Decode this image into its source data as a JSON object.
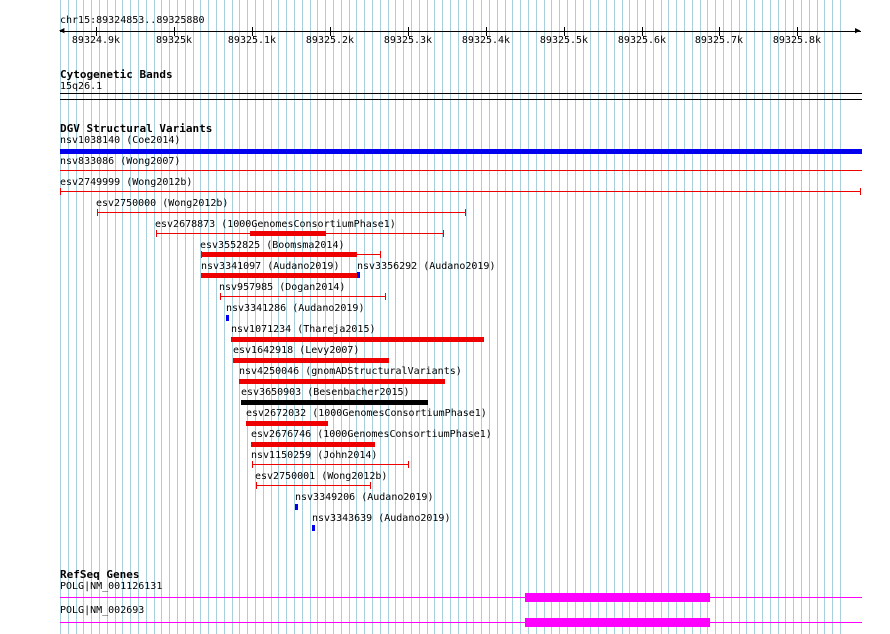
{
  "region": "chr15:89324853..89325880",
  "ruler": {
    "ticks": [
      "89324.9k",
      "89325k",
      "89325.1k",
      "89325.2k",
      "89325.3k",
      "89325.4k",
      "89325.5k",
      "89325.6k",
      "89325.7k",
      "89325.8k"
    ]
  },
  "cyto": {
    "title": "Cytogenetic Bands",
    "band": "15q26.1"
  },
  "dgv": {
    "title": "DGV Structural Variants",
    "tracks": [
      {
        "label": "nsv1038140 (Coe2014)",
        "type": "thick",
        "color": "#0000ee"
      },
      {
        "label": "nsv833086 (Wong2007)",
        "type": "thin",
        "color": "#ee0000"
      },
      {
        "label": "esv2749999 (Wong2012b)",
        "type": "thin",
        "color": "#ee0000"
      },
      {
        "label": "esv2750000 (Wong2012b)",
        "type": "thin",
        "color": "#ee0000"
      },
      {
        "label": "esv2678873 (1000GenomesConsortiumPhase1)",
        "type": "thinwithblock",
        "color": "#ee0000"
      },
      {
        "label": "esv3552825 (Boomsma2014)",
        "type": "thinwithblock",
        "color": "#ee0000"
      },
      {
        "label": "nsv3341097 (Audano2019)",
        "type": "thick",
        "color": "#ee0000"
      },
      {
        "label": "nsv3356292 (Audano2019)",
        "type": "tiny",
        "color": "#0000ee"
      },
      {
        "label": "nsv957985 (Dogan2014)",
        "type": "thin",
        "color": "#ee0000"
      },
      {
        "label": "nsv3341286 (Audano2019)",
        "type": "tiny",
        "color": "#0000ee"
      },
      {
        "label": "nsv1071234 (Thareja2015)",
        "type": "thick",
        "color": "#ee0000"
      },
      {
        "label": "esv1642918 (Levy2007)",
        "type": "thick",
        "color": "#ee0000"
      },
      {
        "label": "nsv4250046 (gnomADStructuralVariants)",
        "type": "thick",
        "color": "#ee0000"
      },
      {
        "label": "esv3650903 (Besenbacher2015)",
        "type": "thick",
        "color": "#000000"
      },
      {
        "label": "esv2672032 (1000GenomesConsortiumPhase1)",
        "type": "thick",
        "color": "#ee0000"
      },
      {
        "label": "esv2676746 (1000GenomesConsortiumPhase1)",
        "type": "thick",
        "color": "#ee0000"
      },
      {
        "label": "nsv1150259 (John2014)",
        "type": "thin",
        "color": "#ee0000"
      },
      {
        "label": "esv2750001 (Wong2012b)",
        "type": "thin",
        "color": "#ee0000"
      },
      {
        "label": "nsv3349206 (Audano2019)",
        "type": "tiny",
        "color": "#0000ee"
      },
      {
        "label": "nsv3343639 (Audano2019)",
        "type": "tiny",
        "color": "#0000ee"
      }
    ]
  },
  "refseq": {
    "title": "RefSeq Genes",
    "genes": [
      {
        "label": "POLG|NM_001126131",
        "color": "#ff00ff"
      },
      {
        "label": "POLG|NM_002693",
        "color": "#ff00ff"
      }
    ]
  },
  "colors": {
    "grid": "#a8d0dc",
    "variant_red": "#ee0000",
    "variant_blue": "#0000ee",
    "gene_magenta": "#ff00ff"
  }
}
